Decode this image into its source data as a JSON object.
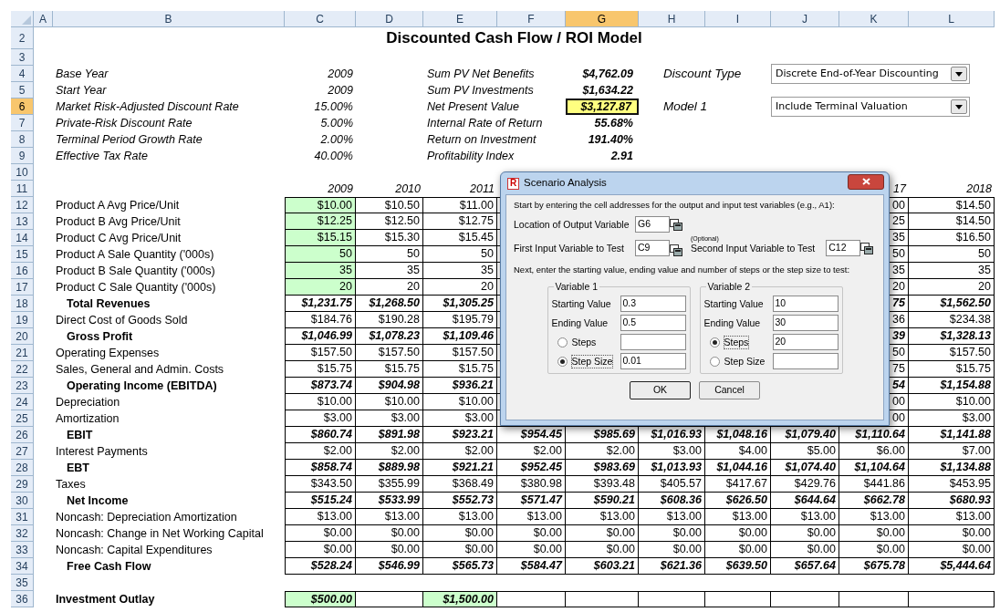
{
  "columns": [
    {
      "label": "A",
      "selected": false
    },
    {
      "label": "B",
      "selected": false
    },
    {
      "label": "C",
      "selected": false
    },
    {
      "label": "D",
      "selected": false
    },
    {
      "label": "E",
      "selected": false
    },
    {
      "label": "F",
      "selected": false
    },
    {
      "label": "G",
      "selected": true
    },
    {
      "label": "H",
      "selected": false
    },
    {
      "label": "I",
      "selected": false
    },
    {
      "label": "J",
      "selected": false
    },
    {
      "label": "K",
      "selected": false
    },
    {
      "label": "L",
      "selected": false
    }
  ],
  "rows": [
    {
      "number": "2",
      "selected": false,
      "kind": "title",
      "text": "Discounted Cash Flow / ROI Model"
    },
    {
      "number": "3",
      "selected": false,
      "kind": "blank"
    },
    {
      "number": "4",
      "selected": false,
      "kind": "assumption",
      "left": {
        "label": "Base Year",
        "value": "2009"
      },
      "middle": {
        "label": "Sum PV Net Benefits",
        "value": "$4,762.09",
        "selected": false
      },
      "right": {
        "label": "Discount Type",
        "dropdown": "Discrete End-of-Year Discounting"
      }
    },
    {
      "number": "5",
      "selected": false,
      "kind": "assumption",
      "left": {
        "label": "Start Year",
        "value": "2009"
      },
      "middle": {
        "label": "Sum PV Investments",
        "value": "$1,634.22",
        "selected": false
      }
    },
    {
      "number": "6",
      "selected": true,
      "kind": "assumption",
      "left": {
        "label": "Market Risk-Adjusted Discount Rate",
        "value": "15.00%"
      },
      "middle": {
        "label": "Net Present Value",
        "value": "$3,127.87",
        "selected": true
      },
      "right": {
        "label": "Model 1",
        "dropdown": "Include Terminal Valuation"
      }
    },
    {
      "number": "7",
      "selected": false,
      "kind": "assumption",
      "left": {
        "label": "Private-Risk Discount Rate",
        "value": "5.00%"
      },
      "middle": {
        "label": "Internal Rate of Return",
        "value": "55.68%",
        "selected": false
      }
    },
    {
      "number": "8",
      "selected": false,
      "kind": "assumption",
      "left": {
        "label": "Terminal Period Growth Rate",
        "value": "2.00%"
      },
      "middle": {
        "label": "Return on Investment",
        "value": "191.40%",
        "selected": false
      }
    },
    {
      "number": "9",
      "selected": false,
      "kind": "assumption",
      "left": {
        "label": "Effective Tax Rate",
        "value": "40.00%"
      },
      "middle": {
        "label": "Profitability Index",
        "value": "2.91",
        "selected": false
      }
    },
    {
      "number": "10",
      "selected": false,
      "kind": "blank"
    },
    {
      "number": "11",
      "selected": false,
      "kind": "years",
      "values": [
        "2009",
        "2010",
        "2011"
      ],
      "right_values": [
        "17",
        "2018"
      ]
    },
    {
      "number": "12",
      "selected": false,
      "kind": "line",
      "label": "Product A Avg Price/Unit",
      "bold": false,
      "indented": false,
      "values": [
        {
          "text": "$10.00",
          "input": true
        },
        {
          "text": "$10.50",
          "input": false
        },
        {
          "text": "$11.00",
          "input": false
        }
      ],
      "right_values": [
        "00",
        "$14.50"
      ]
    },
    {
      "number": "13",
      "selected": false,
      "kind": "line",
      "label": "Product B Avg Price/Unit",
      "bold": false,
      "indented": false,
      "values": [
        {
          "text": "$12.25",
          "input": true
        },
        {
          "text": "$12.50",
          "input": false
        },
        {
          "text": "$12.75",
          "input": false
        }
      ],
      "right_values": [
        "25",
        "$14.50"
      ]
    },
    {
      "number": "14",
      "selected": false,
      "kind": "line",
      "label": "Product C Avg Price/Unit",
      "bold": false,
      "indented": false,
      "values": [
        {
          "text": "$15.15",
          "input": true
        },
        {
          "text": "$15.30",
          "input": false
        },
        {
          "text": "$15.45",
          "input": false
        }
      ],
      "right_values": [
        "35",
        "$16.50"
      ]
    },
    {
      "number": "15",
      "selected": false,
      "kind": "line",
      "label": "Product A Sale Quantity ('000s)",
      "bold": false,
      "indented": false,
      "values": [
        {
          "text": "50",
          "input": true
        },
        {
          "text": "50",
          "input": false
        },
        {
          "text": "50",
          "input": false
        }
      ],
      "right_values": [
        "50",
        "50"
      ]
    },
    {
      "number": "16",
      "selected": false,
      "kind": "line",
      "label": "Product B Sale Quantity ('000s)",
      "bold": false,
      "indented": false,
      "values": [
        {
          "text": "35",
          "input": true
        },
        {
          "text": "35",
          "input": false
        },
        {
          "text": "35",
          "input": false
        }
      ],
      "right_values": [
        "35",
        "35"
      ]
    },
    {
      "number": "17",
      "selected": false,
      "kind": "line",
      "label": "Product C Sale Quantity ('000s)",
      "bold": false,
      "indented": false,
      "values": [
        {
          "text": "20",
          "input": true
        },
        {
          "text": "20",
          "input": false
        },
        {
          "text": "20",
          "input": false
        }
      ],
      "right_values": [
        "20",
        "20"
      ]
    },
    {
      "number": "18",
      "selected": false,
      "kind": "line",
      "label": "Total Revenues",
      "bold": true,
      "indented": true,
      "values": [
        "$1,231.75",
        "$1,268.50",
        "$1,305.25"
      ],
      "right_values": [
        "75",
        "$1,562.50"
      ]
    },
    {
      "number": "19",
      "selected": false,
      "kind": "line",
      "label": "Direct Cost of Goods Sold",
      "bold": false,
      "indented": false,
      "values": [
        "$184.76",
        "$190.28",
        "$195.79"
      ],
      "right_values": [
        "36",
        "$234.38"
      ]
    },
    {
      "number": "20",
      "selected": false,
      "kind": "line",
      "label": "Gross Profit",
      "bold": true,
      "indented": true,
      "values": [
        "$1,046.99",
        "$1,078.23",
        "$1,109.46"
      ],
      "right_values": [
        "39",
        "$1,328.13"
      ]
    },
    {
      "number": "21",
      "selected": false,
      "kind": "line",
      "label": "Operating Expenses",
      "bold": false,
      "indented": false,
      "values": [
        "$157.50",
        "$157.50",
        "$157.50"
      ],
      "right_values": [
        "50",
        "$157.50"
      ]
    },
    {
      "number": "22",
      "selected": false,
      "kind": "line",
      "label": "Sales, General and Admin. Costs",
      "bold": false,
      "indented": false,
      "values": [
        "$15.75",
        "$15.75",
        "$15.75"
      ],
      "right_values": [
        "75",
        "$15.75"
      ]
    },
    {
      "number": "23",
      "selected": false,
      "kind": "line",
      "label": "Operating Income (EBITDA)",
      "bold": true,
      "indented": true,
      "values": [
        "$873.74",
        "$904.98",
        "$936.21"
      ],
      "right_values": [
        "54",
        "$1,154.88"
      ]
    },
    {
      "number": "24",
      "selected": false,
      "kind": "line",
      "label": "Depreciation",
      "bold": false,
      "indented": false,
      "values": [
        "$10.00",
        "$10.00",
        "$10.00"
      ],
      "right_values": [
        "00",
        "$10.00"
      ]
    },
    {
      "number": "25",
      "selected": false,
      "kind": "line",
      "label": "Amortization",
      "bold": false,
      "indented": false,
      "values": [
        "$3.00",
        "$3.00",
        "$3.00"
      ],
      "right_values": [
        "00",
        "$3.00"
      ]
    },
    {
      "number": "26",
      "selected": false,
      "kind": "line",
      "label": "EBIT",
      "bold": true,
      "indented": true,
      "values": [
        "$860.74",
        "$891.98",
        "$923.21",
        "$954.45",
        "$985.69",
        "$1,016.93",
        "$1,048.16",
        "$1,079.40",
        "$1,110.64",
        "$1,141.88"
      ]
    },
    {
      "number": "27",
      "selected": false,
      "kind": "line",
      "label": "Interest Payments",
      "bold": false,
      "indented": false,
      "values": [
        "$2.00",
        "$2.00",
        "$2.00",
        "$2.00",
        "$2.00",
        "$3.00",
        "$4.00",
        "$5.00",
        "$6.00",
        "$7.00"
      ]
    },
    {
      "number": "28",
      "selected": false,
      "kind": "line",
      "label": "EBT",
      "bold": true,
      "indented": true,
      "values": [
        "$858.74",
        "$889.98",
        "$921.21",
        "$952.45",
        "$983.69",
        "$1,013.93",
        "$1,044.16",
        "$1,074.40",
        "$1,104.64",
        "$1,134.88"
      ]
    },
    {
      "number": "29",
      "selected": false,
      "kind": "line",
      "label": "Taxes",
      "bold": false,
      "indented": false,
      "values": [
        "$343.50",
        "$355.99",
        "$368.49",
        "$380.98",
        "$393.48",
        "$405.57",
        "$417.67",
        "$429.76",
        "$441.86",
        "$453.95"
      ]
    },
    {
      "number": "30",
      "selected": false,
      "kind": "line",
      "label": "Net Income",
      "bold": true,
      "indented": true,
      "values": [
        "$515.24",
        "$533.99",
        "$552.73",
        "$571.47",
        "$590.21",
        "$608.36",
        "$626.50",
        "$644.64",
        "$662.78",
        "$680.93"
      ]
    },
    {
      "number": "31",
      "selected": false,
      "kind": "line",
      "label": "Noncash: Depreciation Amortization",
      "bold": false,
      "indented": false,
      "values": [
        "$13.00",
        "$13.00",
        "$13.00",
        "$13.00",
        "$13.00",
        "$13.00",
        "$13.00",
        "$13.00",
        "$13.00",
        "$13.00"
      ]
    },
    {
      "number": "32",
      "selected": false,
      "kind": "line",
      "label": "Noncash: Change in Net Working Capital",
      "bold": false,
      "indented": false,
      "values": [
        "$0.00",
        "$0.00",
        "$0.00",
        "$0.00",
        "$0.00",
        "$0.00",
        "$0.00",
        "$0.00",
        "$0.00",
        "$0.00"
      ]
    },
    {
      "number": "33",
      "selected": false,
      "kind": "line",
      "label": "Noncash: Capital Expenditures",
      "bold": false,
      "indented": false,
      "values": [
        "$0.00",
        "$0.00",
        "$0.00",
        "$0.00",
        "$0.00",
        "$0.00",
        "$0.00",
        "$0.00",
        "$0.00",
        "$0.00"
      ]
    },
    {
      "number": "34",
      "selected": false,
      "kind": "line",
      "label": "Free Cash Flow",
      "bold": true,
      "indented": true,
      "values": [
        "$528.24",
        "$546.99",
        "$565.73",
        "$584.47",
        "$603.21",
        "$621.36",
        "$639.50",
        "$657.64",
        "$675.78",
        "$5,444.64"
      ]
    },
    {
      "number": "35",
      "selected": false,
      "kind": "blank"
    },
    {
      "number": "36",
      "selected": false,
      "kind": "line",
      "label": "Investment Outlay",
      "bold": true,
      "indented": false,
      "values": [
        {
          "text": "$500.00",
          "input": true
        },
        {
          "input": false
        },
        {
          "text": "$1,500.00",
          "input": true
        }
      ]
    }
  ],
  "dialog": {
    "icon_letter": "R",
    "title": "Scenario Analysis",
    "intro": "Start by entering the cell addresses for the output and input test variables (e.g., A1):",
    "output_label": "Location of Output Variable",
    "output_value": "G6",
    "first_label": "First Input Variable to Test",
    "first_value": "C9",
    "optional_note": "(Optional)",
    "second_label": "Second Input Variable to Test",
    "second_value": "C12",
    "next_text": "Next, enter the starting value, ending value and number of steps or the step size to test:",
    "groups": [
      {
        "title": "Variable 1",
        "start_label": "Starting Value",
        "start_value": "0.3",
        "end_label": "Ending Value",
        "end_value": "0.5",
        "options": [
          {
            "label": "Steps",
            "selected": false
          },
          {
            "label": "Step Size",
            "selected": true,
            "value": "0.01"
          }
        ]
      },
      {
        "title": "Variable 2",
        "start_label": "Starting Value",
        "start_value": "10",
        "end_label": "Ending Value",
        "end_value": "30",
        "options": [
          {
            "label": "Steps",
            "selected": true,
            "value": "20"
          },
          {
            "label": "Step Size",
            "selected": false
          }
        ]
      }
    ],
    "buttons": [
      "OK",
      "Cancel"
    ]
  }
}
